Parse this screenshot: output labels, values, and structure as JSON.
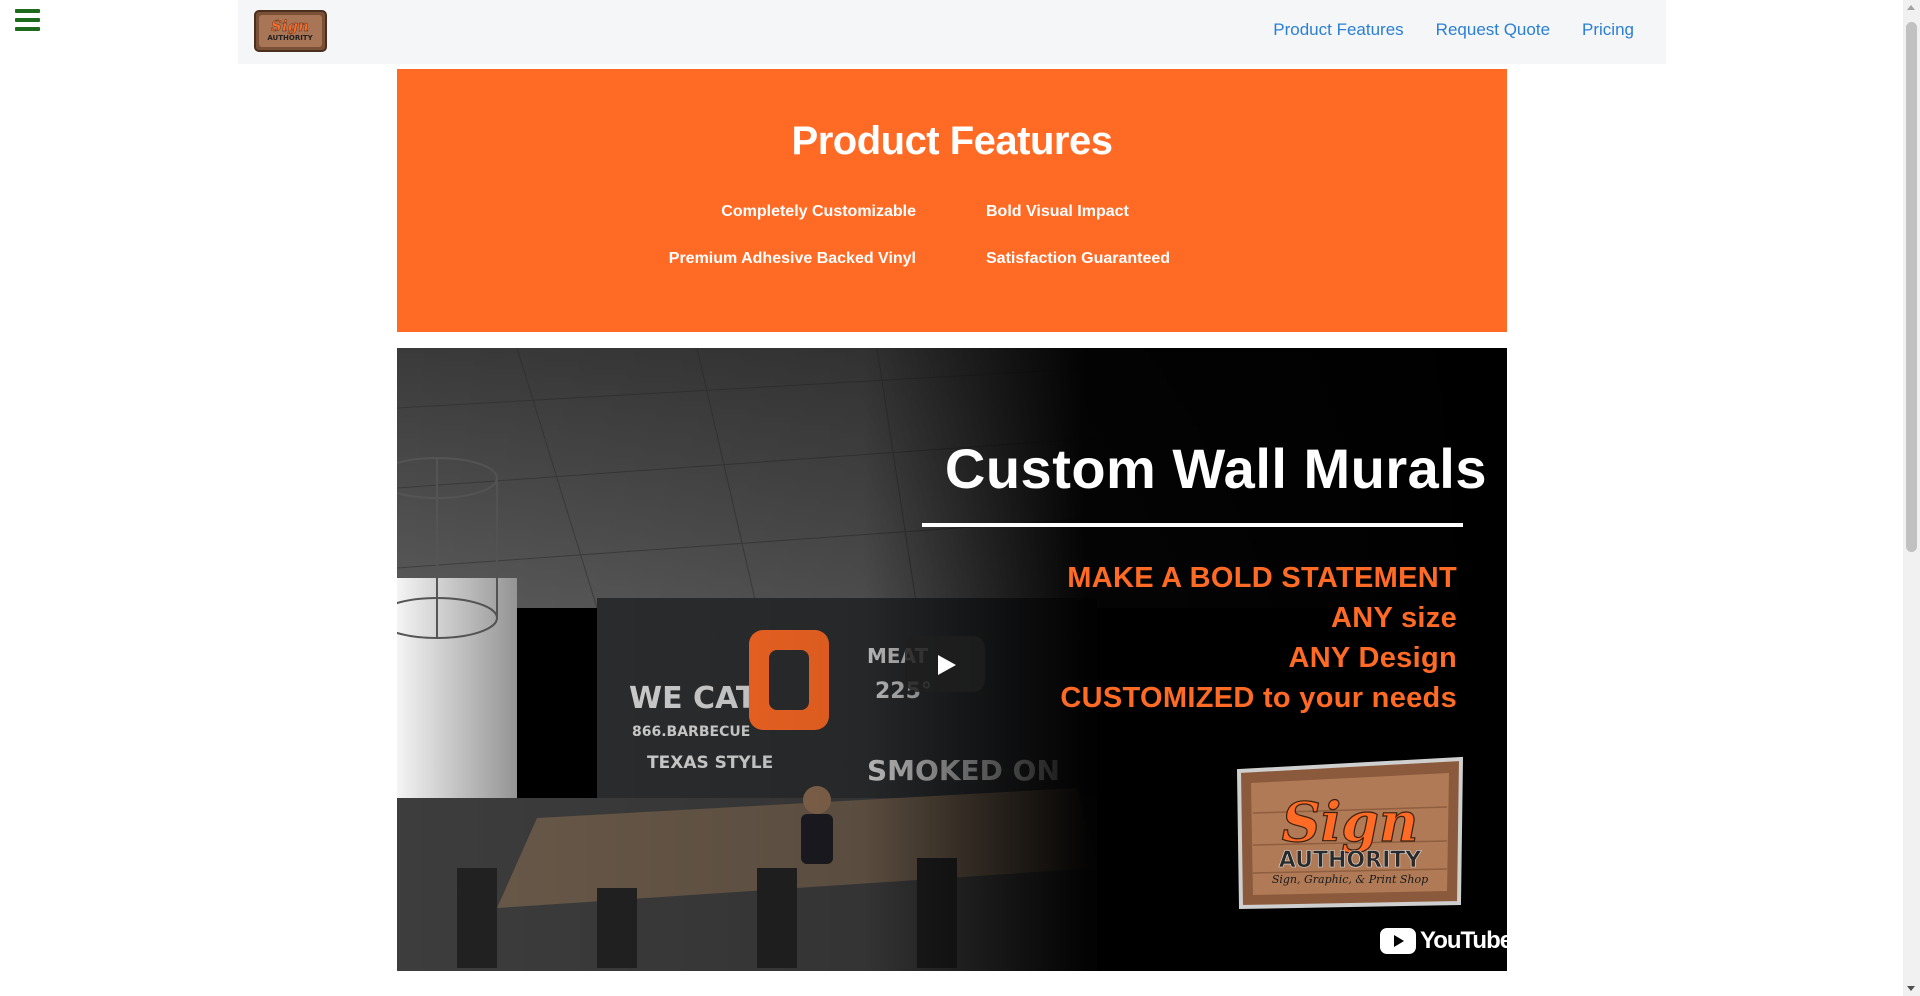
{
  "menu": {
    "icon": "hamburger-menu-icon"
  },
  "navbar": {
    "logo_icon": "sign-authority-logo",
    "links": [
      {
        "label": "Product Features"
      },
      {
        "label": "Request Quote"
      },
      {
        "label": "Pricing"
      }
    ],
    "link_color": "#2a7fd4"
  },
  "features": {
    "title": "Product Features",
    "background": "#ff6a25",
    "items": [
      "Completely Customizable",
      "Bold Visual Impact",
      "Premium Adhesive Backed Vinyl",
      "Satisfaction Guaranteed"
    ]
  },
  "video": {
    "headline": "Custom Wall Murals",
    "promo": {
      "line1_prefix": "MAKE A ",
      "line1_bold": "BOLD",
      "line1_suffix": " STATEMENT",
      "line2": "ANY size",
      "line3": "ANY Design",
      "line4": "CUSTOMIZED to your needs"
    },
    "accent": "#ff6a25",
    "play_icon": "play-icon",
    "platform": "YouTube"
  }
}
